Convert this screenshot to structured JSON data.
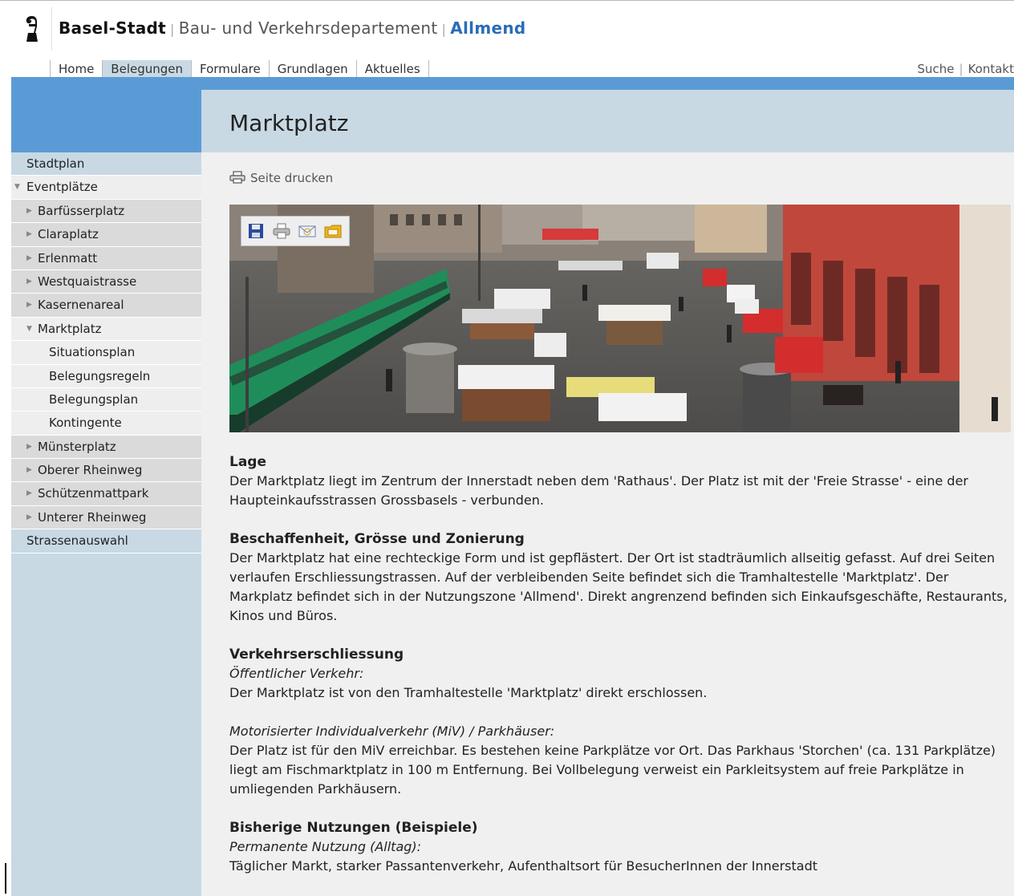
{
  "header": {
    "org": "Basel-Stadt",
    "dept": "Bau- und Verkehrsdepartement",
    "unit": "Allmend"
  },
  "topnav": {
    "items": [
      "Home",
      "Belegungen",
      "Formulare",
      "Grundlagen",
      "Aktuelles"
    ],
    "active": "Belegungen"
  },
  "utilnav": {
    "search": "Suche",
    "contact": "Kontakt"
  },
  "sidebar": {
    "items": [
      {
        "label": "Stadtplan"
      },
      {
        "label": "Eventplätze"
      },
      {
        "label": "Barfüsserplatz"
      },
      {
        "label": "Claraplatz"
      },
      {
        "label": "Erlenmatt"
      },
      {
        "label": "Westquaistrasse"
      },
      {
        "label": "Kasernenareal"
      },
      {
        "label": "Marktplatz"
      },
      {
        "label": "Situationsplan"
      },
      {
        "label": "Belegungsregeln"
      },
      {
        "label": "Belegungsplan"
      },
      {
        "label": "Kontingente"
      },
      {
        "label": "Münsterplatz"
      },
      {
        "label": "Oberer Rheinweg"
      },
      {
        "label": "Schützenmattpark"
      },
      {
        "label": "Unterer Rheinweg"
      },
      {
        "label": "Strassenauswahl"
      }
    ]
  },
  "page": {
    "title": "Marktplatz",
    "print_label": "Seite drucken"
  },
  "article": {
    "lage": {
      "heading": "Lage",
      "text": "Der Marktplatz liegt im Zentrum der Innerstadt neben dem 'Rathaus'. Der Platz ist mit der 'Freie Strasse' - eine der Haupteinkaufsstrassen Grossbasels - verbunden."
    },
    "beschaffenheit": {
      "heading": "Beschaffenheit, Grösse und Zonierung",
      "text": "Der Marktplatz hat eine rechteckige Form und ist gepflästert. Der Ort ist stadträumlich allseitig gefasst. Auf drei Seiten verlaufen Erschliessungstrassen. Auf der verbleibenden Seite befindet sich die Tramhaltestelle 'Marktplatz'. Der Markplatz befindet sich in der Nutzungszone 'Allmend'. Direkt angrenzend befinden sich Einkaufsgeschäfte, Restaurants, Kinos und Büros."
    },
    "verkehr": {
      "heading": "Verkehrserschliessung",
      "sub1": "Öffentlicher Verkehr:",
      "text1": "Der Marktplatz ist von den Tramhaltestelle 'Marktplatz' direkt erschlossen.",
      "sub2": "Motorisierter Individualverkehr (MiV) / Parkhäuser:",
      "text2": "Der Platz ist für den MiV erreichbar. Es bestehen keine Parkplätze vor Ort. Das Parkhaus 'Storchen' (ca. 131 Parkplätze) liegt am Fischmarktplatz in 100 m Entfernung. Bei Vollbelegung verweist ein Parkleitsystem auf freie Parkplätze in umliegenden Parkhäusern."
    },
    "nutzungen": {
      "heading": "Bisherige Nutzungen (Beispiele)",
      "sub1": "Permanente Nutzung (Alltag):",
      "text1": "Täglicher Markt, starker Passantenverkehr, Aufenthaltsort für BesucherInnen der Innerstadt"
    }
  },
  "colors": {
    "accent_blue": "#5b9bd5",
    "pale_blue": "#c8d9e4",
    "link_blue": "#2a6cb8"
  },
  "icons": [
    "basel-crosier-icon",
    "printer-icon",
    "save-icon",
    "print-icon",
    "email-icon",
    "folder-icon"
  ]
}
